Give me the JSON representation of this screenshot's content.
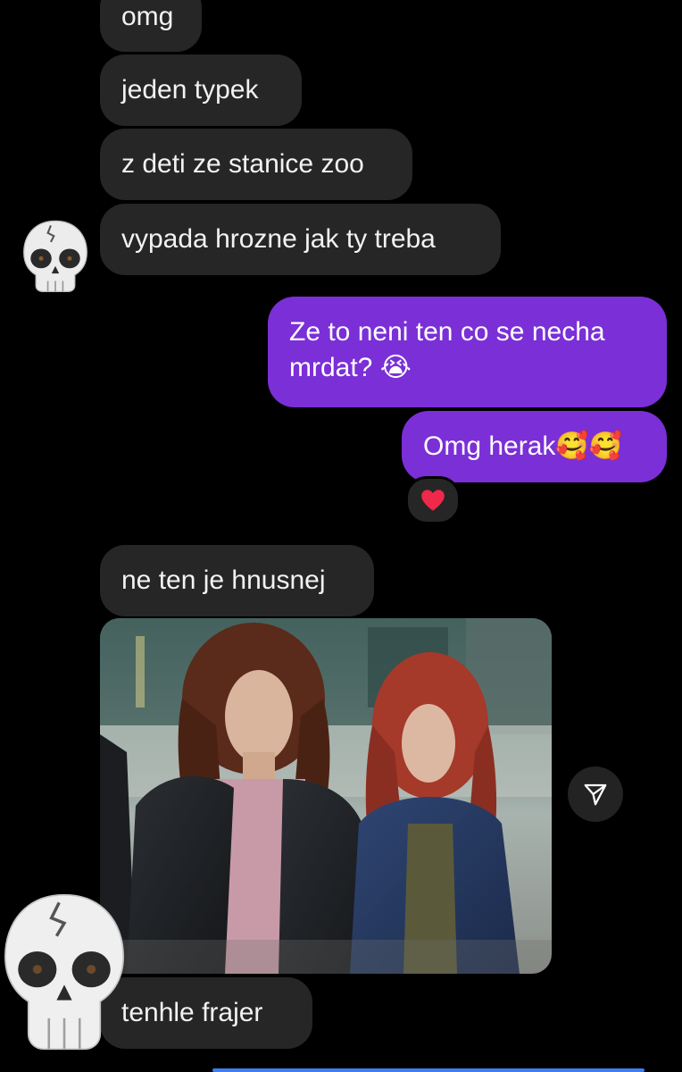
{
  "thread": {
    "incoming_1": [
      "omg",
      "jeden typek",
      "z deti ze stanice zoo",
      "vypada hrozne jak ty treba"
    ],
    "outgoing": [
      "Ze to neni ten co se necha mrdat? 😭",
      "Omg herak🥰🥰"
    ],
    "reaction": "❤️",
    "incoming_2": [
      "ne ten je hnusnej"
    ],
    "photo_caption": "tenhle frajer"
  },
  "icons": {
    "avatar": "skull-emoji-icon",
    "share": "paper-plane-icon"
  },
  "colors": {
    "background": "#000000",
    "incoming_bubble": "#262626",
    "outgoing_bubble": "#7b2fd6",
    "text": "#f2f2f2"
  }
}
